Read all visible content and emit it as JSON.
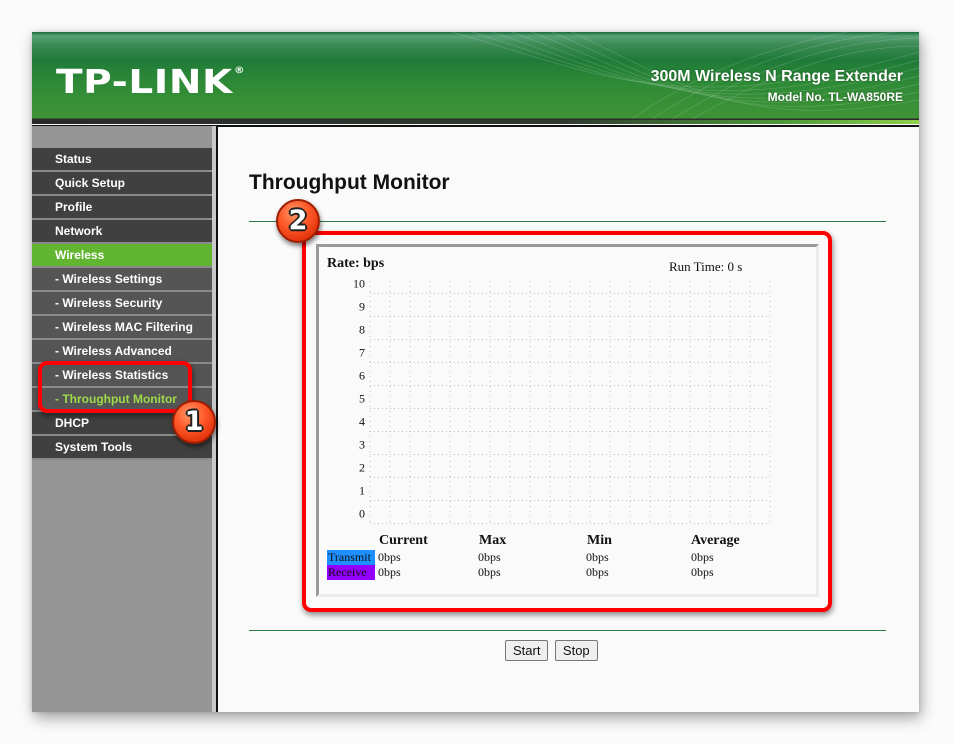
{
  "header": {
    "logo": "TP-LINK",
    "logo_mark": "®",
    "product_title": "300M Wireless N Range Extender",
    "model_no": "Model No. TL-WA850RE"
  },
  "sidebar": {
    "items": [
      {
        "label": "Status",
        "type": "main"
      },
      {
        "label": "Quick Setup",
        "type": "main"
      },
      {
        "label": "Profile",
        "type": "main"
      },
      {
        "label": "Network",
        "type": "main"
      },
      {
        "label": "Wireless",
        "type": "main",
        "active": true
      },
      {
        "label": "- Wireless Settings",
        "type": "sub"
      },
      {
        "label": "- Wireless Security",
        "type": "sub"
      },
      {
        "label": "- Wireless MAC Filtering",
        "type": "sub"
      },
      {
        "label": "- Wireless Advanced",
        "type": "sub"
      },
      {
        "label": "- Wireless Statistics",
        "type": "sub"
      },
      {
        "label": "- Throughput Monitor",
        "type": "sub",
        "current": true
      },
      {
        "label": "DHCP",
        "type": "main"
      },
      {
        "label": "System Tools",
        "type": "main"
      }
    ]
  },
  "main": {
    "page_title": "Throughput Monitor",
    "rate_label": "Rate: bps",
    "run_time": "Run Time: 0 s",
    "buttons": {
      "start": "Start",
      "stop": "Stop"
    }
  },
  "chart_data": {
    "type": "line",
    "title": "Rate: bps",
    "ylabel": "bps",
    "xlabel": "",
    "ylim": [
      0,
      10
    ],
    "y_ticks": [
      "10",
      "9",
      "8",
      "7",
      "6",
      "5",
      "4",
      "3",
      "2",
      "1",
      "0"
    ],
    "x_gridlines": 20,
    "grid": true,
    "series": [
      {
        "name": "Transmit",
        "color": "#1e90ff",
        "values": []
      },
      {
        "name": "Receive",
        "color": "#9400ff",
        "values": []
      }
    ]
  },
  "stats": {
    "columns": [
      "Current",
      "Max",
      "Min",
      "Average"
    ],
    "rows": [
      {
        "label": "Transmit",
        "color": "#1e90ff",
        "values": [
          "0bps",
          "0bps",
          "0bps",
          "0bps"
        ]
      },
      {
        "label": "Receive",
        "color": "#9400ff",
        "values": [
          "0bps",
          "0bps",
          "0bps",
          "0bps"
        ]
      }
    ]
  },
  "annotations": {
    "badge_1": "1",
    "badge_2": "2",
    "color": "#ff0000"
  }
}
